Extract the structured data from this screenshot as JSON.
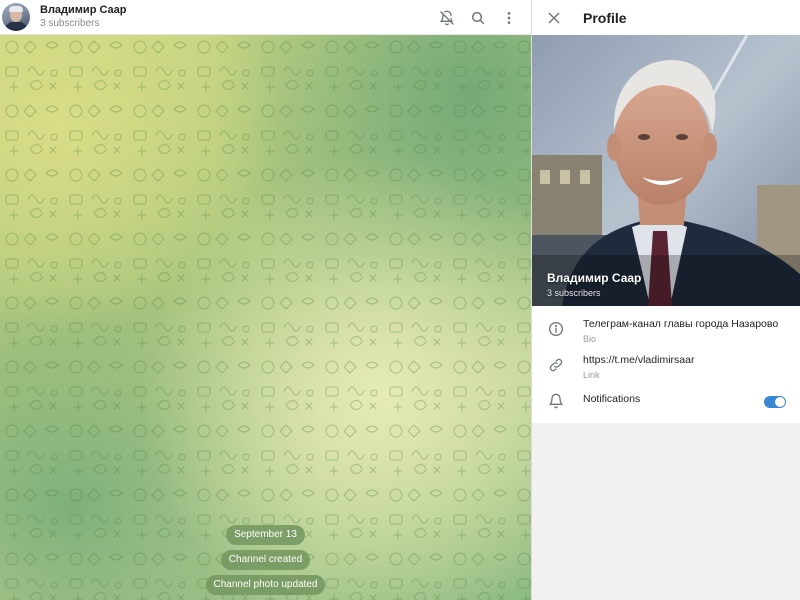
{
  "channel": {
    "name": "Владимир Саар",
    "subscribers": "3 subscribers"
  },
  "header_icons": [
    "bell-slash-icon",
    "search-icon",
    "more-vertical-icon"
  ],
  "service_messages": [
    "September 13",
    "Channel created",
    "Channel photo updated"
  ],
  "profile": {
    "title": "Profile",
    "name": "Владимир Саар",
    "subscribers": "3 subscribers",
    "bio": "Телеграм-канал главы города Назарово",
    "bio_label": "Bio",
    "link": "https://t.me/vladimirsaar",
    "link_label": "Link",
    "notifications_label": "Notifications",
    "notifications_enabled": true
  },
  "colors": {
    "accent": "#3a87d6",
    "pill": "#73965f"
  }
}
